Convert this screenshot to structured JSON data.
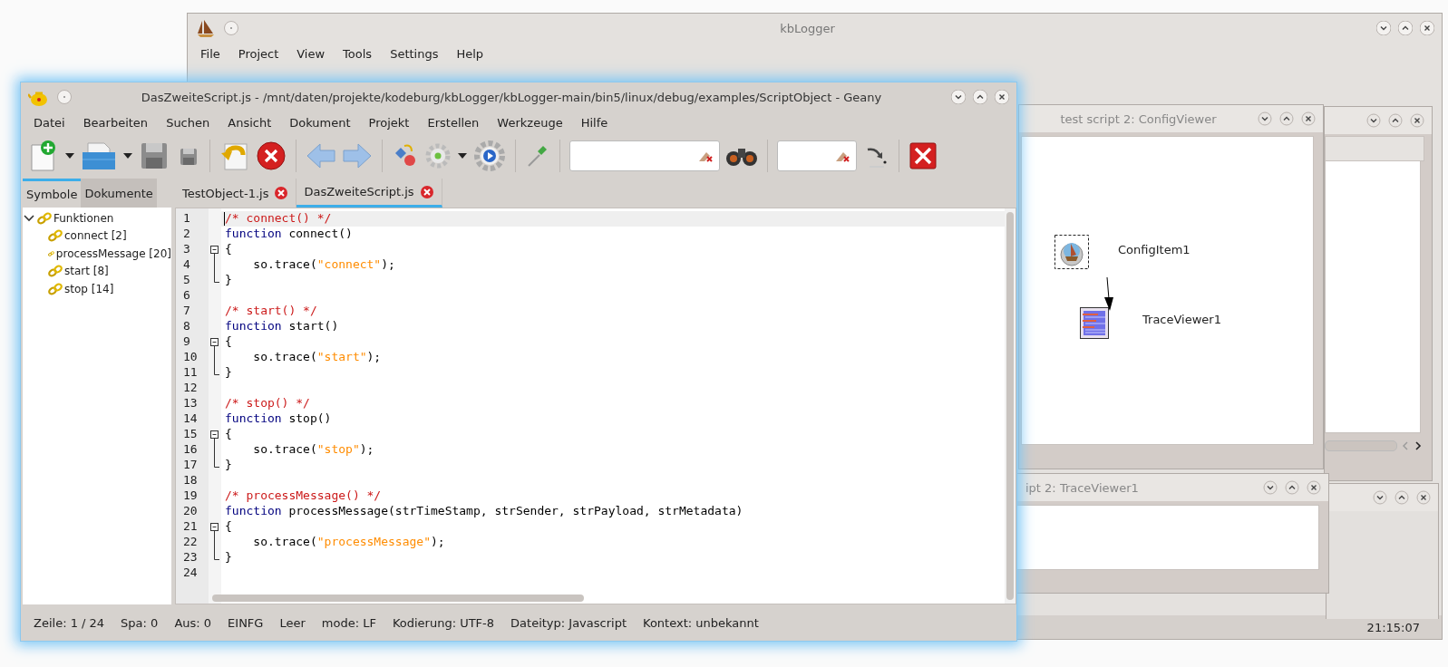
{
  "kblogger": {
    "title": "kbLogger",
    "menu": [
      "File",
      "Project",
      "View",
      "Tools",
      "Settings",
      "Help"
    ],
    "clock": "21:15:07"
  },
  "config_viewer": {
    "title": "test script 2: ConfigViewer",
    "nodes": [
      {
        "kind": "config",
        "label": "ConfigItem1"
      },
      {
        "kind": "trace",
        "label": "TraceViewer1"
      }
    ]
  },
  "trace_viewer": {
    "title": "ipt 2: TraceViewer1"
  },
  "geany": {
    "title": "DasZweiteScript.js - /mnt/daten/projekte/kodeburg/kbLogger/kbLogger-main/bin5/linux/debug/examples/ScriptObject - Geany",
    "menu": [
      "Datei",
      "Bearbeiten",
      "Suchen",
      "Ansicht",
      "Dokument",
      "Projekt",
      "Erstellen",
      "Werkzeuge",
      "Hilfe"
    ],
    "sidebar_tabs": [
      {
        "label": "Symbole",
        "selected": true
      },
      {
        "label": "Dokumente",
        "selected": false
      }
    ],
    "tree": [
      {
        "label": "Funktionen",
        "expanded": true,
        "children": [
          {
            "label": "connect [2]"
          },
          {
            "label": "processMessage [20]"
          },
          {
            "label": "start [8]"
          },
          {
            "label": "stop [14]"
          }
        ]
      }
    ],
    "file_tabs": [
      {
        "label": "TestObject-1.js",
        "selected": false
      },
      {
        "label": "DasZweiteScript.js",
        "selected": true
      }
    ],
    "lines": [
      {
        "number": "1",
        "current": true,
        "kind": "plain",
        "tokens": [
          {
            "kind": "comment",
            "text": "/* connect() */"
          }
        ]
      },
      {
        "number": "2",
        "current": false,
        "kind": "plain",
        "tokens": [
          {
            "kind": "keyword",
            "text": "function"
          },
          {
            "kind": "plain",
            "text": " connect()"
          }
        ]
      },
      {
        "number": "3",
        "current": false,
        "kind": "fold_start",
        "tokens": [
          {
            "kind": "plain",
            "text": "{"
          }
        ]
      },
      {
        "number": "4",
        "current": false,
        "kind": "fold_body",
        "tokens": [
          {
            "kind": "plain",
            "text": "    so.trace("
          },
          {
            "kind": "string",
            "text": "\"connect\""
          },
          {
            "kind": "plain",
            "text": ");"
          }
        ]
      },
      {
        "number": "5",
        "current": false,
        "kind": "fold_end",
        "tokens": [
          {
            "kind": "plain",
            "text": "}"
          }
        ]
      },
      {
        "number": "6",
        "current": false,
        "kind": "plain"
      },
      {
        "number": "7",
        "current": false,
        "kind": "plain",
        "tokens": [
          {
            "kind": "comment",
            "text": "/* start() */"
          }
        ]
      },
      {
        "number": "8",
        "current": false,
        "kind": "plain",
        "tokens": [
          {
            "kind": "keyword",
            "text": "function"
          },
          {
            "kind": "plain",
            "text": " start()"
          }
        ]
      },
      {
        "number": "9",
        "current": false,
        "kind": "fold_start",
        "tokens": [
          {
            "kind": "plain",
            "text": "{"
          }
        ]
      },
      {
        "number": "10",
        "current": false,
        "kind": "fold_body",
        "tokens": [
          {
            "kind": "plain",
            "text": "    so.trace("
          },
          {
            "kind": "string",
            "text": "\"start\""
          },
          {
            "kind": "plain",
            "text": ");"
          }
        ]
      },
      {
        "number": "11",
        "current": false,
        "kind": "fold_end",
        "tokens": [
          {
            "kind": "plain",
            "text": "}"
          }
        ]
      },
      {
        "number": "12",
        "current": false,
        "kind": "plain"
      },
      {
        "number": "13",
        "current": false,
        "kind": "plain",
        "tokens": [
          {
            "kind": "comment",
            "text": "/* stop() */"
          }
        ]
      },
      {
        "number": "14",
        "current": false,
        "kind": "plain",
        "tokens": [
          {
            "kind": "keyword",
            "text": "function"
          },
          {
            "kind": "plain",
            "text": " stop()"
          }
        ]
      },
      {
        "number": "15",
        "current": false,
        "kind": "fold_start",
        "tokens": [
          {
            "kind": "plain",
            "text": "{"
          }
        ]
      },
      {
        "number": "16",
        "current": false,
        "kind": "fold_body",
        "tokens": [
          {
            "kind": "plain",
            "text": "    so.trace("
          },
          {
            "kind": "string",
            "text": "\"stop\""
          },
          {
            "kind": "plain",
            "text": ");"
          }
        ]
      },
      {
        "number": "17",
        "current": false,
        "kind": "fold_end",
        "tokens": [
          {
            "kind": "plain",
            "text": "}"
          }
        ]
      },
      {
        "number": "18",
        "current": false,
        "kind": "plain"
      },
      {
        "number": "19",
        "current": false,
        "kind": "plain",
        "tokens": [
          {
            "kind": "comment",
            "text": "/* processMessage() */"
          }
        ]
      },
      {
        "number": "20",
        "current": false,
        "kind": "plain",
        "tokens": [
          {
            "kind": "keyword",
            "text": "function"
          },
          {
            "kind": "plain",
            "text": " processMessage(strTimeStamp, strSender, strPayload, strMetadata)"
          }
        ]
      },
      {
        "number": "21",
        "current": false,
        "kind": "fold_start",
        "tokens": [
          {
            "kind": "plain",
            "text": "{"
          }
        ]
      },
      {
        "number": "22",
        "current": false,
        "kind": "fold_body",
        "tokens": [
          {
            "kind": "plain",
            "text": "    so.trace("
          },
          {
            "kind": "string",
            "text": "\"processMessage\""
          },
          {
            "kind": "plain",
            "text": ");"
          }
        ]
      },
      {
        "number": "23",
        "current": false,
        "kind": "fold_end",
        "tokens": [
          {
            "kind": "plain",
            "text": "}"
          }
        ]
      },
      {
        "number": "24",
        "current": false,
        "kind": "plain"
      }
    ],
    "status_bar": [
      "Zeile: 1 / 24",
      "Spa: 0",
      "Aus: 0",
      "EINFG",
      "Leer",
      "mode: LF",
      "Kodierung: UTF-8",
      "Dateityp: Javascript",
      "Kontext: unbekannt"
    ]
  }
}
